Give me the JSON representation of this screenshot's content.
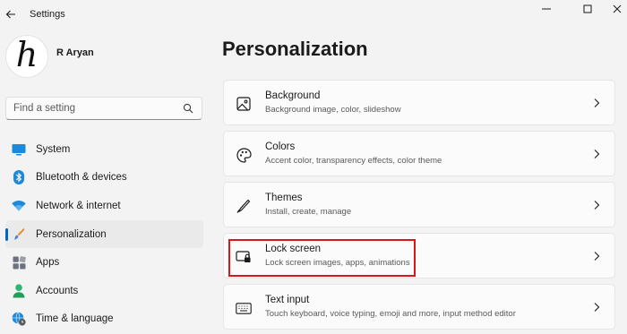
{
  "window": {
    "title": "Settings"
  },
  "user": {
    "name": "R Aryan",
    "avatar_letter": "h"
  },
  "search": {
    "placeholder": "Find a setting"
  },
  "sidebar": {
    "items": [
      {
        "label": "System",
        "icon": "monitor-icon",
        "active": false
      },
      {
        "label": "Bluetooth & devices",
        "icon": "bluetooth-icon",
        "active": false
      },
      {
        "label": "Network & internet",
        "icon": "wifi-icon",
        "active": false
      },
      {
        "label": "Personalization",
        "icon": "brush-icon",
        "active": true
      },
      {
        "label": "Apps",
        "icon": "apps-icon",
        "active": false
      },
      {
        "label": "Accounts",
        "icon": "person-icon",
        "active": false
      },
      {
        "label": "Time & language",
        "icon": "globe-clock-icon",
        "active": false
      }
    ]
  },
  "main": {
    "title": "Personalization",
    "cards": [
      {
        "title": "Background",
        "description": "Background image, color, slideshow",
        "icon": "image-icon"
      },
      {
        "title": "Colors",
        "description": "Accent color, transparency effects, color theme",
        "icon": "palette-icon"
      },
      {
        "title": "Themes",
        "description": "Install, create, manage",
        "icon": "pen-icon"
      },
      {
        "title": "Lock screen",
        "description": "Lock screen images, apps, animations",
        "icon": "lock-screen-icon",
        "highlighted": true
      },
      {
        "title": "Text input",
        "description": "Touch keyboard, voice typing, emoji and more, input method editor",
        "icon": "keyboard-icon"
      }
    ]
  },
  "colors": {
    "accent": "#0067c0",
    "highlight": "#d9161c"
  }
}
